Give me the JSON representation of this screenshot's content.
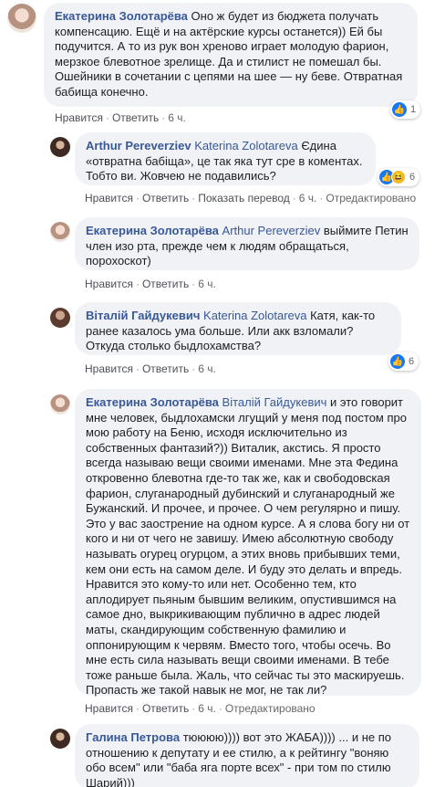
{
  "actions": {
    "like": "Нравится",
    "reply": "Ответить",
    "translate": "Показать перевод",
    "edited": "Отредактировано",
    "separator": "·"
  },
  "comments": [
    {
      "author": "Екатерина Золотарёва",
      "mention": "",
      "text": "Оно ж будет из бюджета получать компенсацию. Ещё и на актёрские курсы останется)) Ей бы подучится. А то из рук вон хреново играет молодую фарион, мерзкое блевотное зрелище. Да и стилист не помешал бы. Ошейники в сочетании с цепями на шее — ну беве. Отвратная бабища конечно.",
      "time": "6 ч.",
      "reactions": "1"
    },
    {
      "author": "Arthur Pereverziev",
      "mention": "Katerina Zolotareva",
      "text": "Єдина «отвратна бабіща», це так яка тут сре в коментах. Тобто ви. Жовчею не подавились?",
      "time": "6 ч.",
      "reactions": "6"
    },
    {
      "author": "Екатерина Золотарёва",
      "mention": "Arthur Pereverziev",
      "text": "выймите Петин член изо рта, прежде чем к людям обращаться, порохоскот)",
      "time": "6 ч."
    },
    {
      "author": "Віталій Гайдукевич",
      "mention": "Katerina Zolotareva",
      "text": "Катя, как-то ранее казалось ума больше. Или акк взломали? Откуда столько быдлохамства?",
      "time": "6 ч.",
      "reactions": "6"
    },
    {
      "author": "Екатерина Золотарёва",
      "mention": "Віталій Гайдукевич",
      "text": "и это говорит мне человек, быдлохамски лгущий у меня под постом про мою работу на Беню, исходя исключительно из собственных фантазий?)) Виталик, акстись. Я просто всегда называю вещи своими именами. Мне эта Федина откровенно блевотна где-то так же, как и свободовская фарион, слуганародный дубинский и слуганародный же Бужанский. И прочее, и прочее. О чем регулярно и пишу. Это у вас заострение на одном курсе. А я слова богу ни от кого и ни от чего не завишу. Имею абсолютную свободу называть огурец огурцом, а этих вновь прибывших теми, кем они есть на самом деле. И буду это делать и впредь. Нравится это кому-то или нет. Особенно тем, кто аплодирует пьяным бывшим великим, опустившимся на самое дно, выкрикивающим публично в адрес людей маты, скандирующим собственную фамилию и оппонирующим к червям. Вместо того, чтобы осечь. Во мне есть сила называть вещи своими именами. В тебе тоже раньше была. Жаль, что сейчас ты это маскируешь. Пропасть же такой навык не мог, не так ли?",
      "time": "6 ч."
    },
    {
      "author": "Галина Петрова",
      "mention": "",
      "text": "тюююю)))) вот это ЖАБА)))) ... и не по отношению к депутату и ее стилю, а к рейтингу \"воняю обо всем\" или \"баба яга порте всех\" - при том по стилю Шарий)))",
      "time": ""
    }
  ]
}
